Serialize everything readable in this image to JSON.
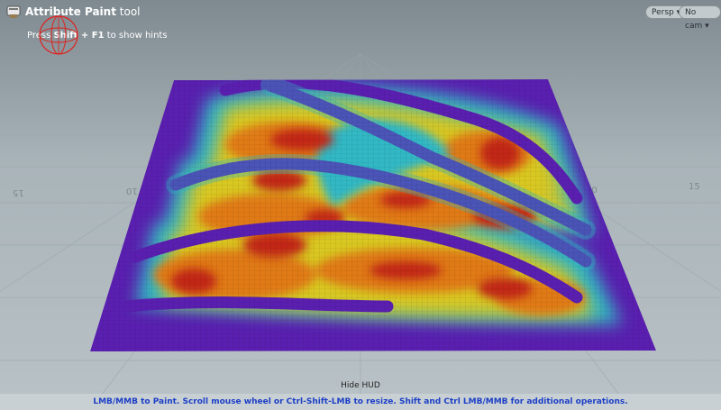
{
  "tool": {
    "name": "Attribute Paint",
    "suffix": "tool",
    "icon": "paint-brush-icon"
  },
  "hint": {
    "prefix": "Press",
    "key": "Shift + F1",
    "suffix": "to show hints"
  },
  "camera": {
    "persp_label": "Persp",
    "cam_label": "No cam"
  },
  "hud": {
    "hide_label": "Hide HUD"
  },
  "statusbar": {
    "message": "LMB/MMB to Paint.  Scroll mouse wheel or Ctrl-Shift-LMB to resize.  Shift and Ctrl LMB/MMB for additional operations."
  },
  "grid_labels": [
    "15",
    "10",
    "10",
    "15"
  ],
  "colors": {
    "background_top": "#7f8a90",
    "background_bottom": "#b9c2c6",
    "base": "#5a1fb0",
    "cyan": "#30b8c4",
    "yellow": "#d9c820",
    "orange": "#e07a18",
    "red": "#c22814",
    "status_text": "#1c3fc7",
    "brush": "#e0201c"
  }
}
